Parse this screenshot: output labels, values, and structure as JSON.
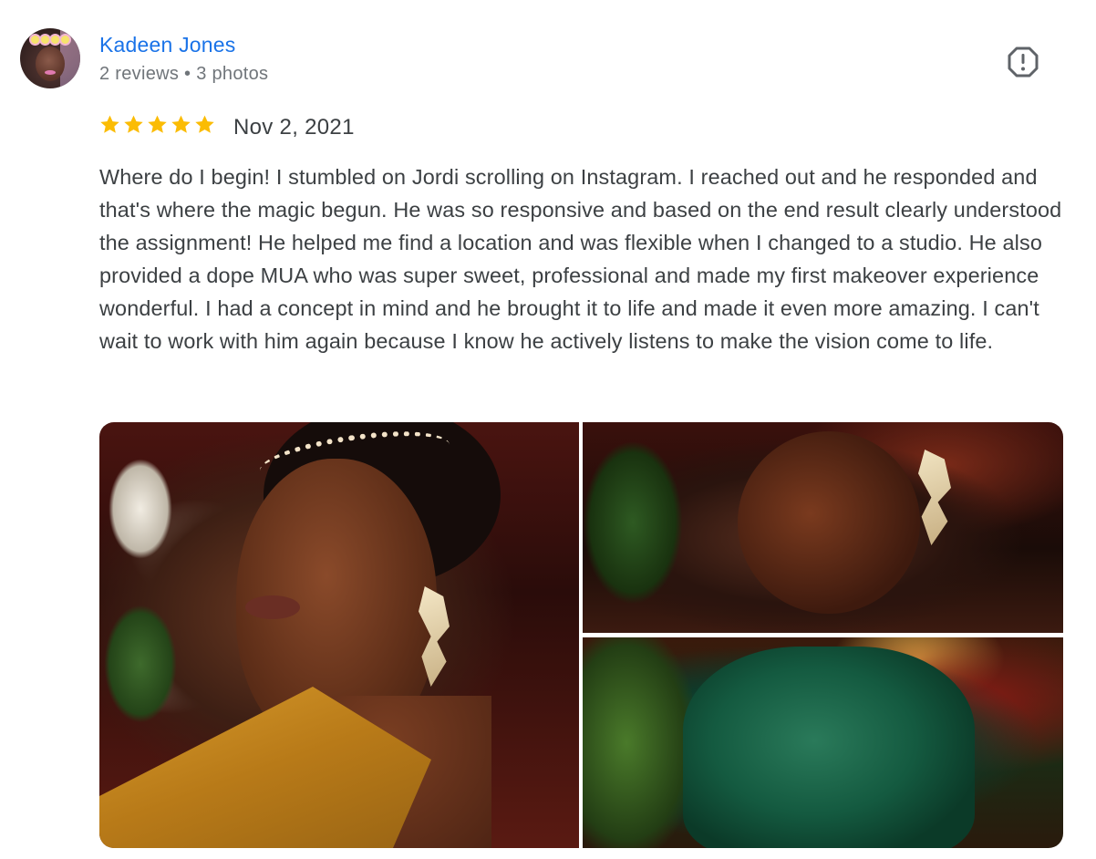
{
  "reviewer": {
    "name": "Kadeen Jones",
    "meta": "2 reviews • 3 photos"
  },
  "review": {
    "rating": 5,
    "max_rating": 5,
    "date": "Nov 2, 2021",
    "text": "Where do I begin! I stumbled on Jordi scrolling on Instagram. I reached out and he responded and that's where the magic begun. He was so responsive and based on the end result clearly understood the assignment! He helped me find a location and was flexible when I changed to a studio. He also provided a dope MUA who was super sweet, professional and made my first makeover experience wonderful. I had a concept in mind and he brought it to life and made it even more amazing. I can't wait to work with him again because I know he actively listens to make the vision come to life."
  },
  "icons": {
    "report": "report-flag-icon",
    "star": "star-icon"
  },
  "colors": {
    "name": "#1a73e8",
    "star": "#fbbc04",
    "meta": "#70757a",
    "text": "#3c4043"
  }
}
